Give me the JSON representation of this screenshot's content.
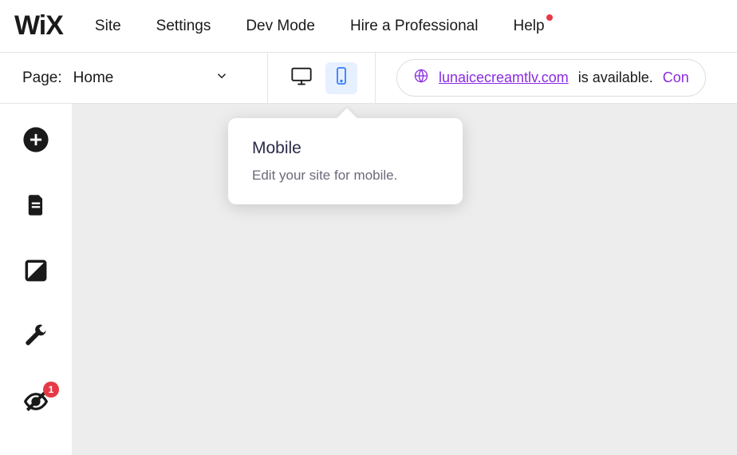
{
  "logo": "WiX",
  "menu": {
    "site": "Site",
    "settings": "Settings",
    "dev_mode": "Dev Mode",
    "hire": "Hire a Professional",
    "help": "Help"
  },
  "page_selector": {
    "label": "Page:",
    "value": "Home"
  },
  "domain": {
    "url": "lunaicecreamtlv.com",
    "available_text": "is available.",
    "cta": "Con"
  },
  "tooltip": {
    "title": "Mobile",
    "body": "Edit your site for mobile."
  },
  "sidebar": {
    "badge_count": "1"
  }
}
